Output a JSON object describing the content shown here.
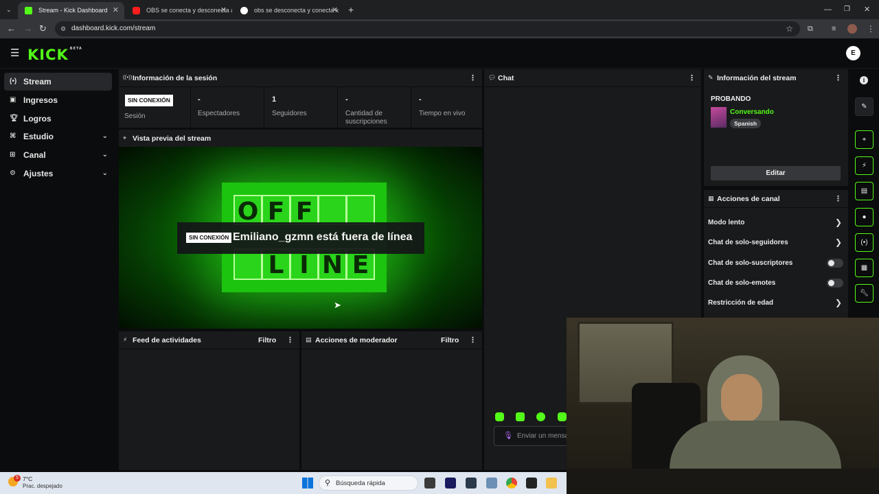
{
  "browser": {
    "tabs": [
      {
        "title": "Stream - Kick Dashboard",
        "active": true
      },
      {
        "title": "OBS se conecta y desconecta a",
        "active": false
      },
      {
        "title": "obs se desconecta y conecta k",
        "active": false
      }
    ],
    "url": "dashboard.kick.com/stream"
  },
  "app": {
    "logo": "KICK",
    "logo_tag": "BETA",
    "avatar_letter": "E"
  },
  "sidebar": {
    "items": [
      {
        "label": "Stream",
        "icon": "broadcast-icon",
        "active": true
      },
      {
        "label": "Ingresos",
        "icon": "money-icon"
      },
      {
        "label": "Logros",
        "icon": "trophy-icon"
      },
      {
        "label": "Estudio",
        "icon": "studio-icon",
        "expandable": true
      },
      {
        "label": "Canal",
        "icon": "channel-icon",
        "expandable": true
      },
      {
        "label": "Ajustes",
        "icon": "gear-icon",
        "expandable": true
      }
    ]
  },
  "session": {
    "title": "Información de la sesión",
    "status_badge": "SIN CONEXIÓN",
    "status_label": "Sesión",
    "stats": [
      {
        "value": "-",
        "label": "Espectadores"
      },
      {
        "value": "1",
        "label": "Seguidores"
      },
      {
        "value": "-",
        "label": "Cantidad de suscripciones"
      },
      {
        "value": "-",
        "label": "Tiempo en vivo"
      }
    ]
  },
  "preview": {
    "title": "Vista previa del stream",
    "sign_top": [
      "O",
      "F",
      "F",
      "",
      ""
    ],
    "sign_bottom": [
      "",
      "L",
      "I",
      "N",
      "E"
    ],
    "offline_badge": "SIN CONEXIÓN",
    "offline_message": "Emiliano_gzmn está fuera de línea"
  },
  "activity": {
    "title": "Feed de actividades",
    "filter": "Filtro"
  },
  "moderator": {
    "title": "Acciones de moderador",
    "filter": "Filtro"
  },
  "chat": {
    "title": "Chat",
    "input_placeholder": "Enviar un mensa"
  },
  "stream_info": {
    "title": "Información del stream",
    "stream_title": "PROBANDO",
    "category": "Conversando",
    "language": "Spanish",
    "edit_label": "Editar"
  },
  "channel_actions": {
    "title": "Acciones de canal",
    "rows": [
      {
        "label": "Modo lento",
        "control": "arrow"
      },
      {
        "label": "Chat de solo-seguidores",
        "control": "arrow"
      },
      {
        "label": "Chat de solo-suscriptores",
        "control": "toggle"
      },
      {
        "label": "Chat de solo-emotes",
        "control": "toggle"
      },
      {
        "label": "Restricción de edad",
        "control": "arrow"
      }
    ]
  },
  "taskbar": {
    "temperature": "7°C",
    "weather": "Prac. despejado",
    "weather_badge": "5",
    "search_placeholder": "Búsqueda rápida"
  },
  "colors": {
    "brand": "#53fc18",
    "panel": "#191a1b",
    "background": "#0b0c0d"
  }
}
